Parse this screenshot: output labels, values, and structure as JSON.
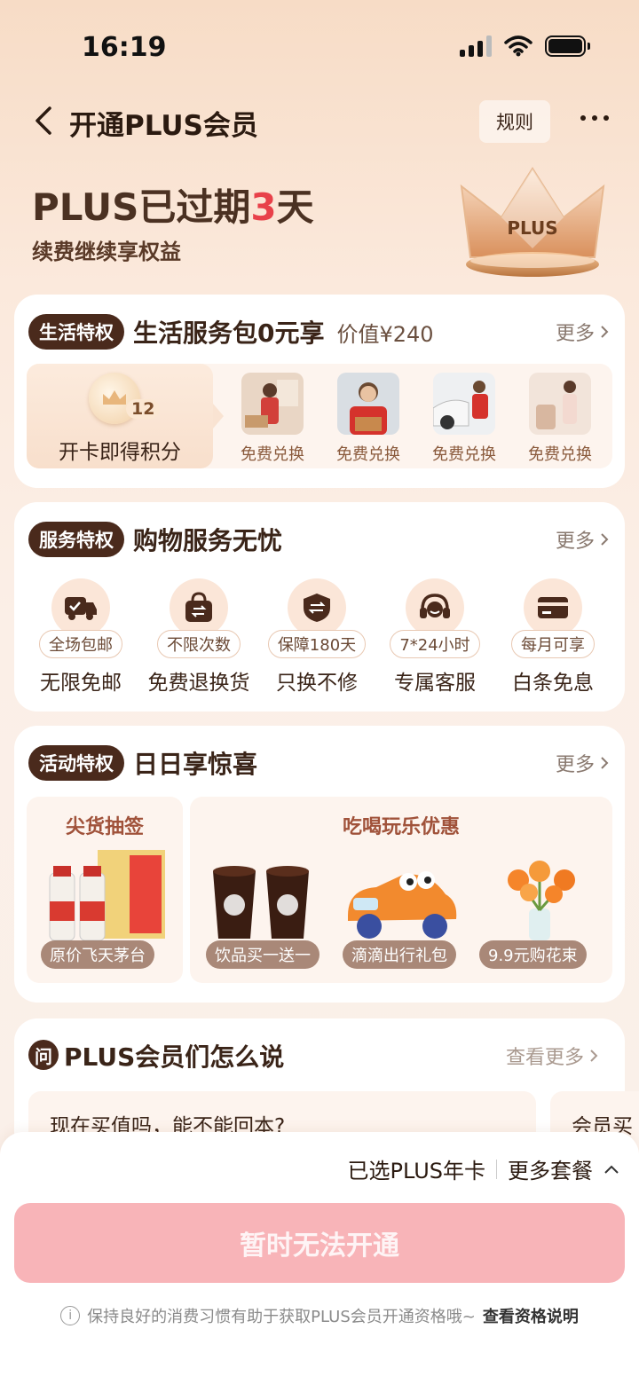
{
  "status": {
    "time": "16:19"
  },
  "nav": {
    "title": "开通PLUS会员",
    "rules": "规则"
  },
  "hero": {
    "prefix": "PLUS已过期",
    "days": "3",
    "suffix": "天",
    "subtitle": "续费继续享权益",
    "crown_label": "PLUS"
  },
  "life": {
    "tag": "生活特权",
    "title": "生活服务包0元享",
    "value": "价值¥240",
    "more": "更多",
    "points_label": "开卡即得积分",
    "points_num": "12",
    "services": [
      {
        "label": "免费兑换"
      },
      {
        "label": "免费兑换"
      },
      {
        "label": "免费兑换"
      },
      {
        "label": "免费兑换"
      }
    ]
  },
  "service": {
    "tag": "服务特权",
    "title": "购物服务无忧",
    "more": "更多",
    "features": [
      {
        "pill": "全场包邮",
        "name": "无限免邮"
      },
      {
        "pill": "不限次数",
        "name": "免费退换货"
      },
      {
        "pill": "保障180天",
        "name": "只换不修"
      },
      {
        "pill": "7*24小时",
        "name": "专属客服"
      },
      {
        "pill": "每月可享",
        "name": "白条免息"
      }
    ]
  },
  "activity": {
    "tag": "活动特权",
    "title": "日日享惊喜",
    "more": "更多",
    "left_title": "尖货抽签",
    "left_pill": "原价飞天茅台",
    "right_title": "吃喝玩乐优惠",
    "right_pills": [
      "饮品买一送一",
      "滴滴出行礼包",
      "9.9元购花束"
    ]
  },
  "reviews": {
    "icon": "问",
    "title": "PLUS会员们怎么说",
    "more": "查看更多",
    "items": [
      "现在买值吗，能不能回本?",
      "会员买"
    ]
  },
  "bottom": {
    "selected": "已选PLUS年卡",
    "more_plans": "更多套餐",
    "cta": "暂时无法开通",
    "note": "保持良好的消费习惯有助于获取PLUS会员开通资格哦~",
    "note_link": "查看资格说明"
  },
  "colors": {
    "accent_red": "#e8414a",
    "tag_brown": "#4a2a1c",
    "cta_pink": "#f8b4b8"
  }
}
